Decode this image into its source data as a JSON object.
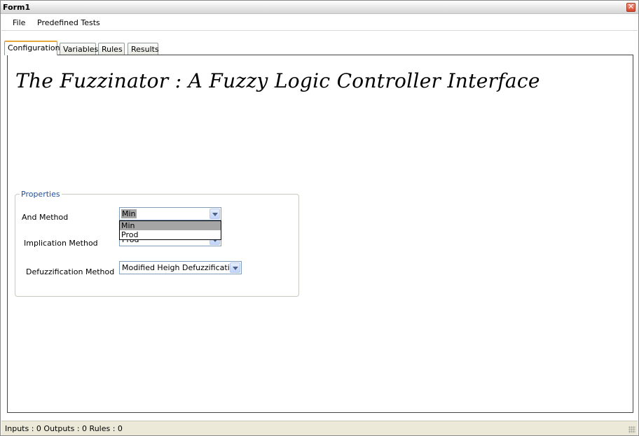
{
  "window": {
    "title": "Form1",
    "close_glyph": "✕"
  },
  "menu": {
    "items": [
      "File",
      "Predefined Tests"
    ]
  },
  "tabs": [
    {
      "label": "Configuration",
      "active": true
    },
    {
      "label": "Variables",
      "active": false
    },
    {
      "label": "Rules",
      "active": false
    },
    {
      "label": "Results",
      "active": false
    }
  ],
  "main": {
    "app_title": "The Fuzzinator : A Fuzzy Logic Controller Interface"
  },
  "properties": {
    "legend": "Properties",
    "and_method": {
      "label": "And Method",
      "value": "Min",
      "options": [
        "Min",
        "Prod"
      ],
      "highlighted": "Min"
    },
    "implication_method": {
      "label": "Implication Method",
      "value": "Prod"
    },
    "defuzzification_method": {
      "label": "Defuzzification Method",
      "value": "Modified Heigh Defuzzification"
    }
  },
  "status": {
    "text": "Inputs : 0  Outputs : 0  Rules : 0"
  },
  "colors": {
    "tab_active_accent": "#e6a83a",
    "legend_text": "#1f4e9c",
    "close_button": "#d9442a"
  },
  "icons": {
    "close": "close-icon",
    "dropdown": "chevron-down-icon",
    "grip": "resize-grip-icon"
  }
}
